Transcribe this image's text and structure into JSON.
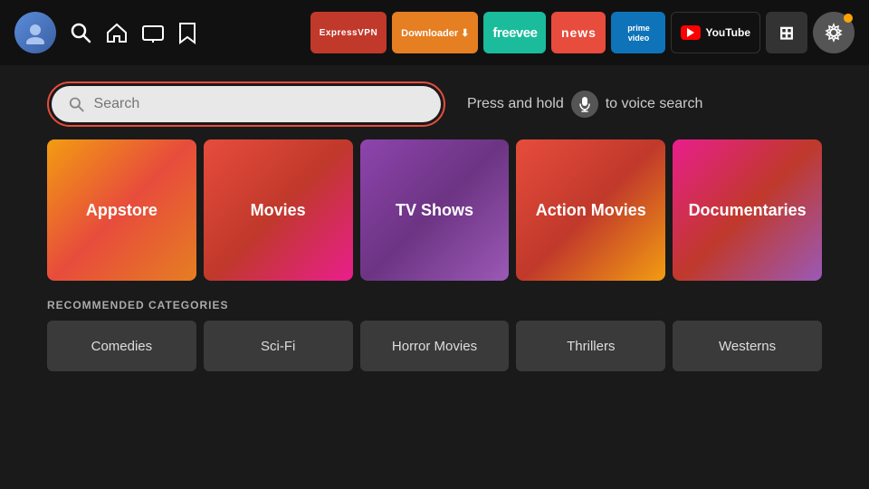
{
  "topbar": {
    "nav_items": [
      {
        "name": "home-icon",
        "symbol": "⌂"
      },
      {
        "name": "tv-icon",
        "symbol": "📺"
      },
      {
        "name": "bookmark-icon",
        "symbol": "🔖"
      }
    ],
    "apps": [
      {
        "name": "expressvpn",
        "label": "ExpressVPN",
        "class": "app-expressvpn"
      },
      {
        "name": "downloader",
        "label": "Downloader ⬇",
        "class": "app-downloader"
      },
      {
        "name": "freevee",
        "label": "freevee",
        "class": "app-freevee"
      },
      {
        "name": "news",
        "label": "news",
        "class": "app-news"
      },
      {
        "name": "prime-video",
        "label": "prime video",
        "class": "app-prime"
      },
      {
        "name": "youtube",
        "label": "YouTube",
        "class": "app-youtube"
      }
    ],
    "settings_dot_color": "#f39c12"
  },
  "search": {
    "placeholder": "Search",
    "voice_hint_pre": "Press and hold",
    "voice_hint_post": "to voice search"
  },
  "categories": [
    {
      "name": "Appstore",
      "css_class": "cat-appstore"
    },
    {
      "name": "Movies",
      "css_class": "cat-movies"
    },
    {
      "name": "TV Shows",
      "css_class": "cat-tvshows"
    },
    {
      "name": "Action Movies",
      "css_class": "cat-action"
    },
    {
      "name": "Documentaries",
      "css_class": "cat-documentaries"
    }
  ],
  "recommended": {
    "label": "RECOMMENDED CATEGORIES",
    "items": [
      {
        "name": "Comedies"
      },
      {
        "name": "Sci-Fi"
      },
      {
        "name": "Horror Movies"
      },
      {
        "name": "Thrillers"
      },
      {
        "name": "Westerns"
      }
    ]
  }
}
